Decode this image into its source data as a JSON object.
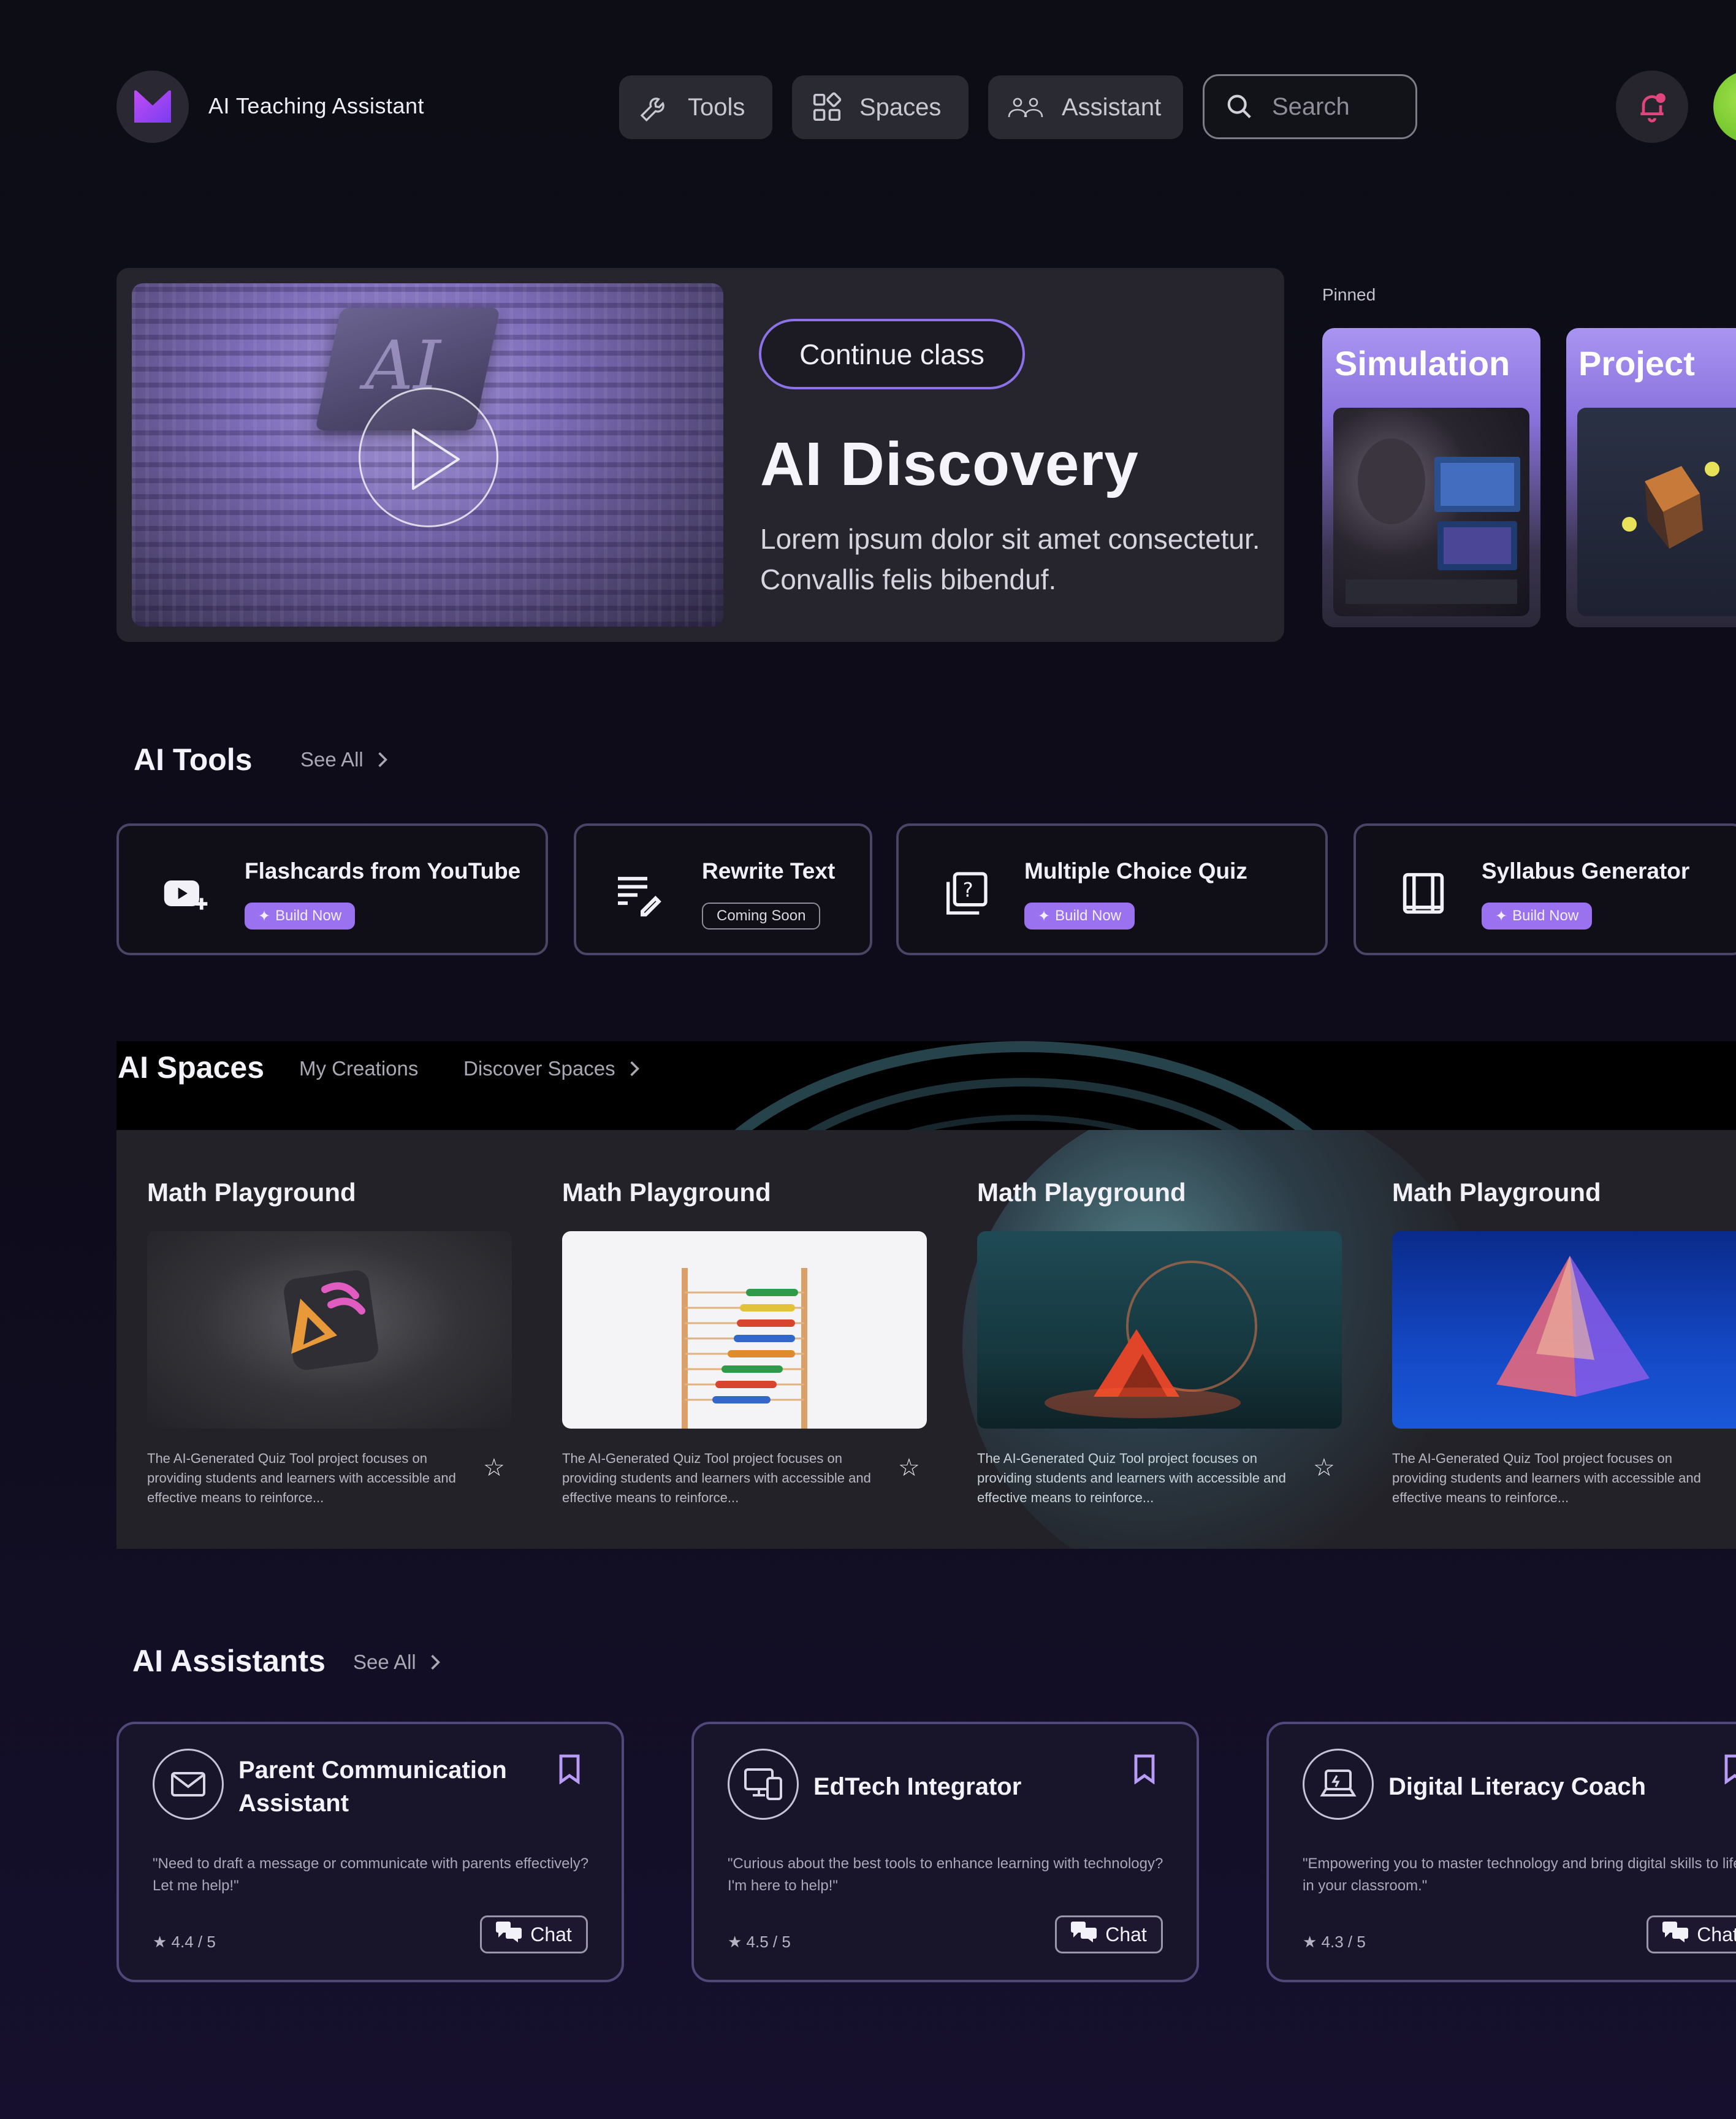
{
  "header": {
    "app_title": "AI Teaching Assistant",
    "nav": [
      {
        "label": "Tools",
        "icon": "wrench-icon"
      },
      {
        "label": "Spaces",
        "icon": "grid-icon"
      },
      {
        "label": "Assistant",
        "icon": "users-icon"
      }
    ],
    "search_placeholder": "Search"
  },
  "hero": {
    "button_label": "Continue class",
    "title": "AI Discovery",
    "description": "Lorem ipsum dolor sit amet consectetur. Convallis felis bibenduf.",
    "image_text": "AI"
  },
  "pinned": {
    "label": "Pinned",
    "items": [
      {
        "title": "Simulation"
      },
      {
        "title": "Project"
      }
    ]
  },
  "tools": {
    "title": "AI Tools",
    "see_all": "See All",
    "items": [
      {
        "name": "Flashcards from YouTube",
        "badge": "Build Now",
        "badge_type": "build",
        "icon": "youtube-icon"
      },
      {
        "name": "Rewrite Text",
        "badge": "Coming Soon",
        "badge_type": "soon",
        "icon": "rewrite-icon"
      },
      {
        "name": "Multiple Choice Quiz",
        "badge": "Build Now",
        "badge_type": "build",
        "icon": "quiz-icon"
      },
      {
        "name": "Syllabus Generator",
        "badge": "Build Now",
        "badge_type": "build",
        "icon": "syllabus-icon"
      }
    ]
  },
  "spaces": {
    "title": "AI Spaces",
    "tab_my": "My Creations",
    "tab_discover": "Discover Spaces",
    "items": [
      {
        "title": "Math Playground",
        "description": "The AI-Generated Quiz Tool project focuses on providing students and learners with accessible and effective means to reinforce..."
      },
      {
        "title": "Math Playground",
        "description": "The AI-Generated Quiz Tool project focuses on providing students and learners with accessible and effective means to reinforce..."
      },
      {
        "title": "Math Playground",
        "description": "The AI-Generated Quiz Tool project focuses on providing students and learners with accessible and effective means to reinforce..."
      },
      {
        "title": "Math Playground",
        "description": "The AI-Generated Quiz Tool project focuses on providing students and learners with accessible and effective means to reinforce..."
      }
    ]
  },
  "assistants": {
    "title": "AI Assistants",
    "see_all": "See All",
    "items": [
      {
        "name": "Parent Communication Assistant",
        "quote": "\"Need to draft a message or communicate with parents effectively? Let me help!\"",
        "rating": "★ 4.4 / 5",
        "chat": "Chat",
        "icon": "mail-icon"
      },
      {
        "name": "EdTech Integrator",
        "quote": "\"Curious about the best tools to enhance learning with technology? I'm here to help!\"",
        "rating": "★ 4.5 / 5",
        "chat": "Chat",
        "icon": "devices-icon"
      },
      {
        "name": "Digital Literacy Coach",
        "quote": "\"Empowering you to master technology and bring digital skills to life in your classroom.\"",
        "rating": "★ 4.3 / 5",
        "chat": "Chat",
        "icon": "laptop-icon"
      }
    ]
  },
  "colors": {
    "background": "#0d0d16",
    "accent": "#9a72f0",
    "card": "#26252e",
    "bell": "#e0457b"
  }
}
